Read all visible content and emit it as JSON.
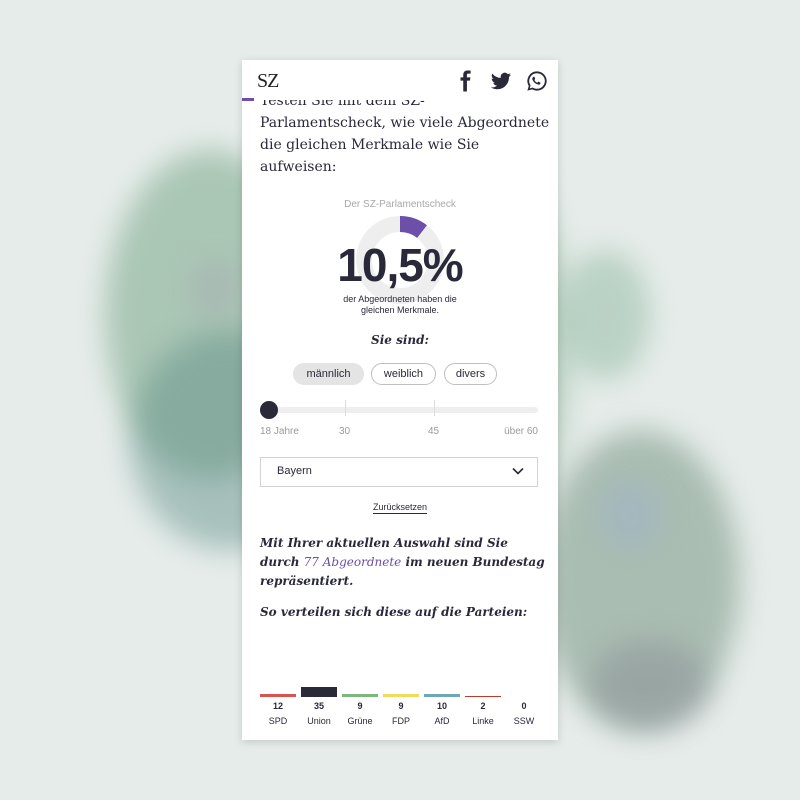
{
  "header": {
    "logo_text": "SZ",
    "icons": [
      "facebook-icon",
      "twitter-icon",
      "whatsapp-icon"
    ]
  },
  "intro_text": "Testen Sie mit dem SZ-Parlamentscheck, wie viele Abgeordnete die gleichen Merkmale wie Sie aufweisen:",
  "check": {
    "title": "Der SZ-Parlamentscheck",
    "percent_label": "10,5%",
    "percent_value": 10.5,
    "subtitle": "der Abgeordneten haben die gleichen Merkmale."
  },
  "gender": {
    "heading": "Sie sind:",
    "options": [
      "männlich",
      "weiblich",
      "divers"
    ],
    "selected": "männlich"
  },
  "age_slider": {
    "labels": [
      "18 Jahre",
      "30",
      "45",
      "über 60"
    ],
    "value_label": "18 Jahre"
  },
  "state_select": {
    "value": "Bayern"
  },
  "reset_label": "Zurücksetzen",
  "result": {
    "prefix": "Mit Ihrer aktuellen Auswahl sind Sie durch ",
    "highlight": "77 Abgeordnete",
    "suffix": " im neuen Bundestag repräsentiert.",
    "count": 77
  },
  "distribution_heading": "So verteilen sich diese auf die Parteien:",
  "chart_data": {
    "type": "bar",
    "categories": [
      "SPD",
      "Union",
      "Grüne",
      "FDP",
      "AfD",
      "Linke",
      "SSW"
    ],
    "values": [
      12,
      35,
      9,
      9,
      10,
      2,
      0
    ],
    "colors": [
      "#d9534f",
      "#29293a",
      "#7cb87c",
      "#f0dc5a",
      "#6ea7b5",
      "#c0392b",
      "#cccccc"
    ],
    "title": "",
    "xlabel": "",
    "ylabel": ""
  },
  "colors": {
    "accent": "#6b4fa8",
    "text": "#29293a"
  }
}
